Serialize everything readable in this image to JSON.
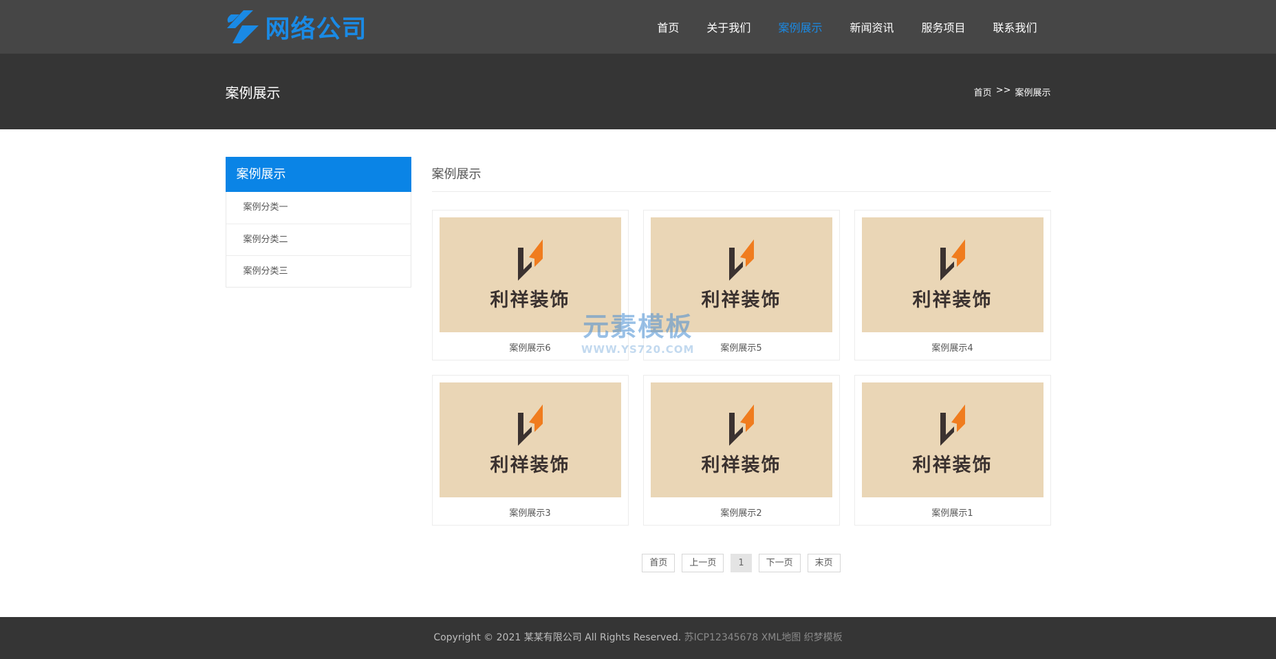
{
  "header": {
    "logo_text": "网络公司",
    "brand_color": "#1a8ae5",
    "nav": [
      {
        "label": "首页",
        "active": false
      },
      {
        "label": "关于我们",
        "active": false
      },
      {
        "label": "案例展示",
        "active": true
      },
      {
        "label": "新闻资讯",
        "active": false
      },
      {
        "label": "服务项目",
        "active": false
      },
      {
        "label": "联系我们",
        "active": false
      }
    ]
  },
  "banner": {
    "title": "案例展示",
    "breadcrumb": {
      "home": "首页",
      "separator": ">>",
      "current": "案例展示"
    }
  },
  "sidebar": {
    "title": "案例展示",
    "items": [
      {
        "label": "案例分类一"
      },
      {
        "label": "案例分类二"
      },
      {
        "label": "案例分类三"
      }
    ]
  },
  "content": {
    "title": "案例展示",
    "cases": [
      {
        "label": "案例展示6",
        "image_text": "利祥装饰"
      },
      {
        "label": "案例展示5",
        "image_text": "利祥装饰"
      },
      {
        "label": "案例展示4",
        "image_text": "利祥装饰"
      },
      {
        "label": "案例展示3",
        "image_text": "利祥装饰"
      },
      {
        "label": "案例展示2",
        "image_text": "利祥装饰"
      },
      {
        "label": "案例展示1",
        "image_text": "利祥装饰"
      }
    ]
  },
  "pagination": {
    "first": "首页",
    "prev": "上一页",
    "current": "1",
    "next": "下一页",
    "last": "末页"
  },
  "watermark": {
    "main": "元素模板",
    "sub": "WWW.YS720.COM"
  },
  "footer": {
    "copyright": "Copyright © 2021 某某有限公司 All Rights Reserved.",
    "icp": "苏ICP12345678",
    "sitemap": "XML地图",
    "template": "织梦模板"
  }
}
